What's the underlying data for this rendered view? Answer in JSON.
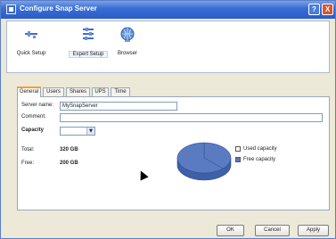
{
  "window": {
    "title": "Configure Snap Server",
    "help_label": "?",
    "close_label": "X"
  },
  "toolbar": {
    "items": [
      {
        "label": "Quick Setup",
        "icon": "quick-setup-icon"
      },
      {
        "label": "Expert Setup",
        "icon": "expert-setup-icon"
      },
      {
        "label": "Browser",
        "icon": "globe-icon"
      }
    ]
  },
  "tabs": [
    "General",
    "Users",
    "Shares",
    "UPS",
    "Time"
  ],
  "general": {
    "server_name_label": "Server name:",
    "server_name_value": "MySnapServer",
    "comment_label": "Comment:",
    "comment_value": "",
    "capacity_label": "Capacity",
    "capacity_selected": "",
    "total_label": "Total:",
    "total_value": "320 GB",
    "free_label": "Free:",
    "free_value": "200 GB",
    "legend_used": "Used capacity",
    "legend_free": "Free capacity"
  },
  "chart_data": {
    "type": "pie",
    "title": "",
    "slices": [
      {
        "label": "Used capacity",
        "value": 120,
        "color": "#ffffff"
      },
      {
        "label": "Free capacity",
        "value": 200,
        "color": "#5a7bc2"
      }
    ]
  },
  "buttons": {
    "ok": "OK",
    "cancel": "Cancel",
    "apply": "Apply"
  },
  "colors": {
    "accent": "#3b6fd6",
    "pie_fill": "#5a7bc2",
    "active_tab": "#f0a030"
  }
}
